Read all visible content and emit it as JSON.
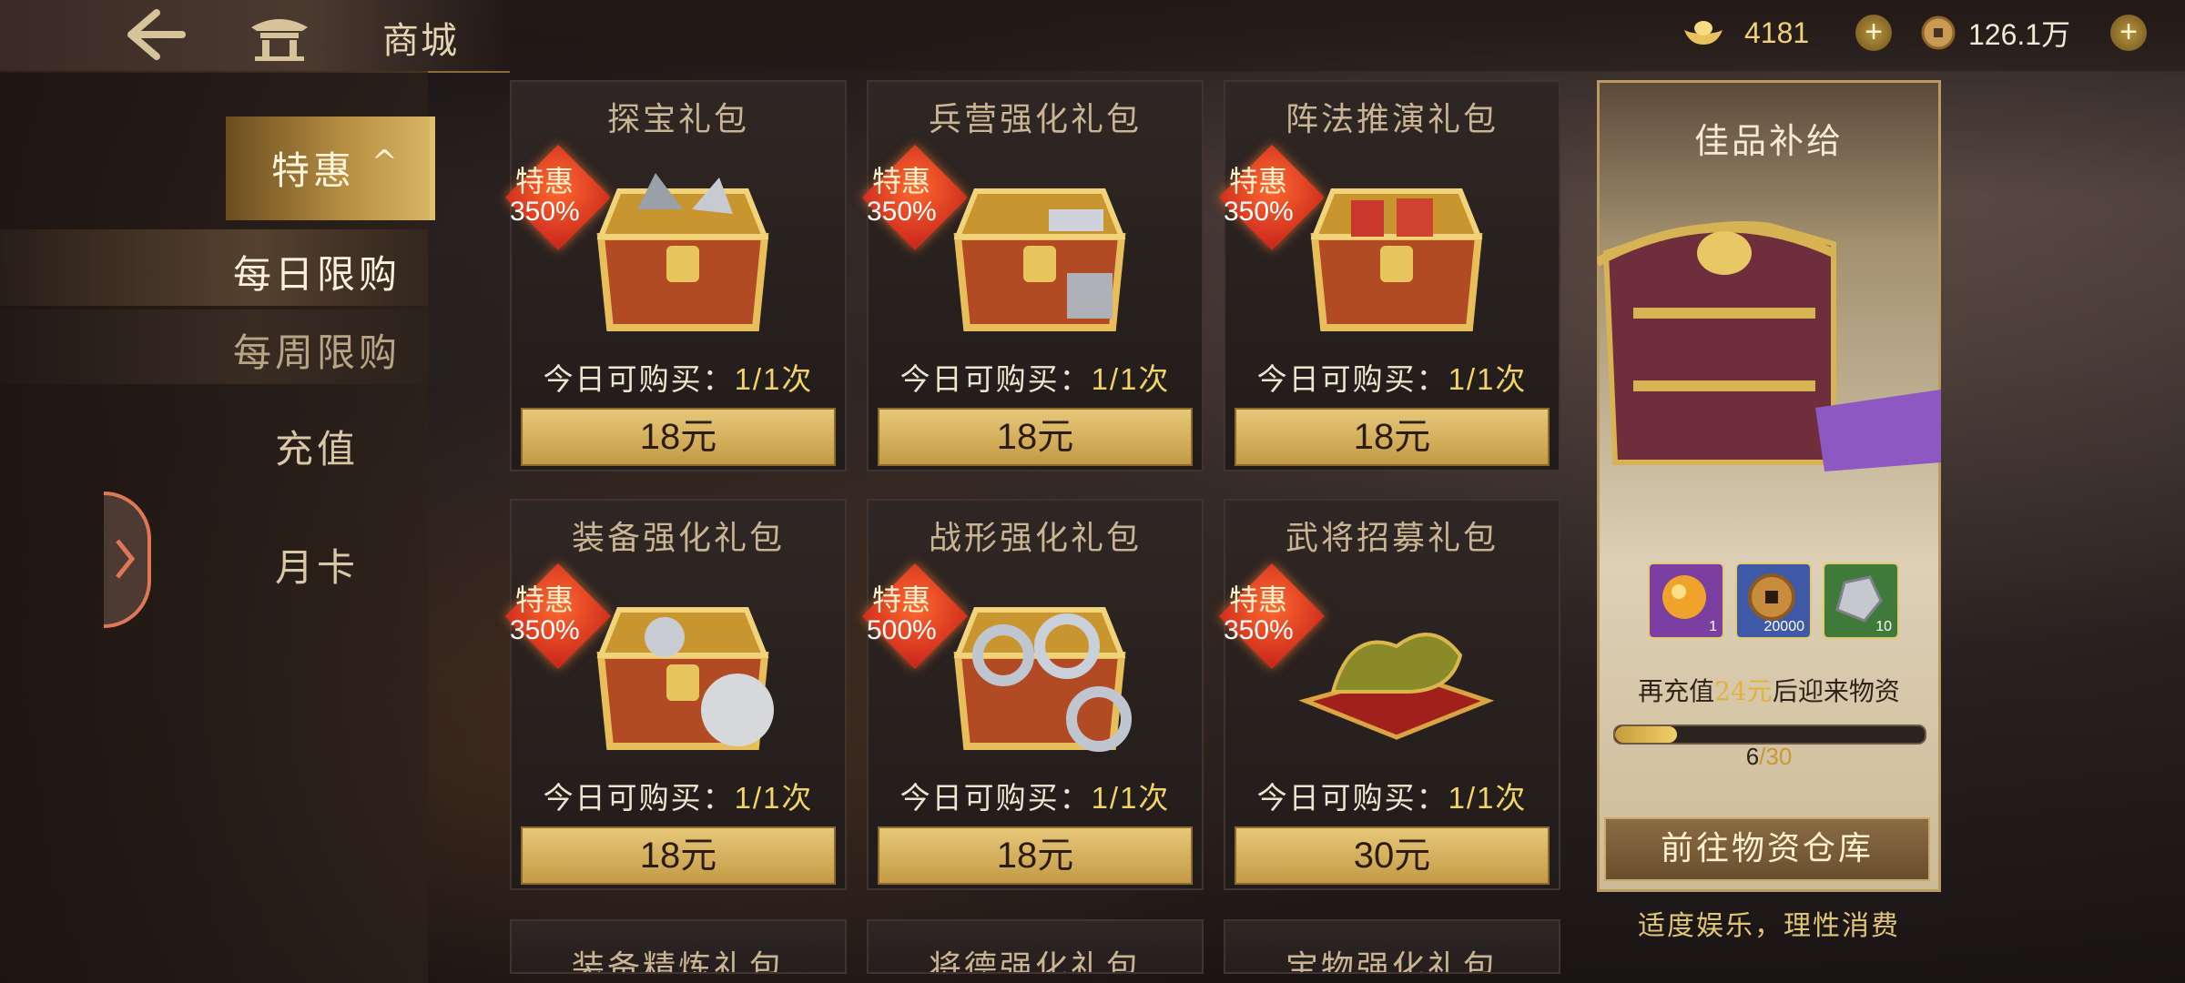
{
  "header": {
    "title": "商城",
    "back_icon": "arrow-left-icon",
    "home_icon": "pavilion-home-icon",
    "gold": {
      "icon": "gold-ingot-icon",
      "amount": "4181"
    },
    "copper": {
      "icon": "copper-coin-icon",
      "amount": "126.1万"
    }
  },
  "menu": {
    "active": {
      "label": "特惠",
      "caret": "^"
    },
    "sub_items": [
      "每日限购",
      "每周限购"
    ],
    "items": [
      "充值",
      "月卡"
    ]
  },
  "cards": [
    {
      "title": "探宝礼包",
      "badge": "特惠",
      "pct": "350%",
      "limit_label": "今日可购买：",
      "limit_count": "1/1次",
      "price": "18元"
    },
    {
      "title": "兵营强化礼包",
      "badge": "特惠",
      "pct": "350%",
      "limit_label": "今日可购买：",
      "limit_count": "1/1次",
      "price": "18元"
    },
    {
      "title": "阵法推演礼包",
      "badge": "特惠",
      "pct": "350%",
      "limit_label": "今日可购买：",
      "limit_count": "1/1次",
      "price": "18元"
    },
    {
      "title": "装备强化礼包",
      "badge": "特惠",
      "pct": "350%",
      "limit_label": "今日可购买：",
      "limit_count": "1/1次",
      "price": "18元"
    },
    {
      "title": "战形强化礼包",
      "badge": "特惠",
      "pct": "500%",
      "limit_label": "今日可购买：",
      "limit_count": "1/1次",
      "price": "18元"
    },
    {
      "title": "武将招募礼包",
      "badge": "特惠",
      "pct": "350%",
      "limit_label": "今日可购买：",
      "limit_count": "1/1次",
      "price": "30元"
    }
  ],
  "partial_cards": [
    "装备精炼礼包",
    "将德强化礼包",
    "宝物强化礼包"
  ],
  "supply": {
    "title": "佳品补给",
    "items": [
      {
        "icon": "gold-orb-icon",
        "qty": "1",
        "color": "#7a3fa0"
      },
      {
        "icon": "square-hole-coin-icon",
        "qty": "20000",
        "color": "#3d59a8"
      },
      {
        "icon": "silver-ore-icon",
        "qty": "10",
        "color": "#3f7a3a"
      }
    ],
    "msg_prefix": "再充值",
    "msg_amount": "24元",
    "msg_suffix": "后迎来物资",
    "progress_current": "6",
    "progress_total": "/30",
    "progress_fraction": 0.2,
    "button": "前往物资仓库"
  },
  "footer_note": "适度娱乐，理性消费"
}
